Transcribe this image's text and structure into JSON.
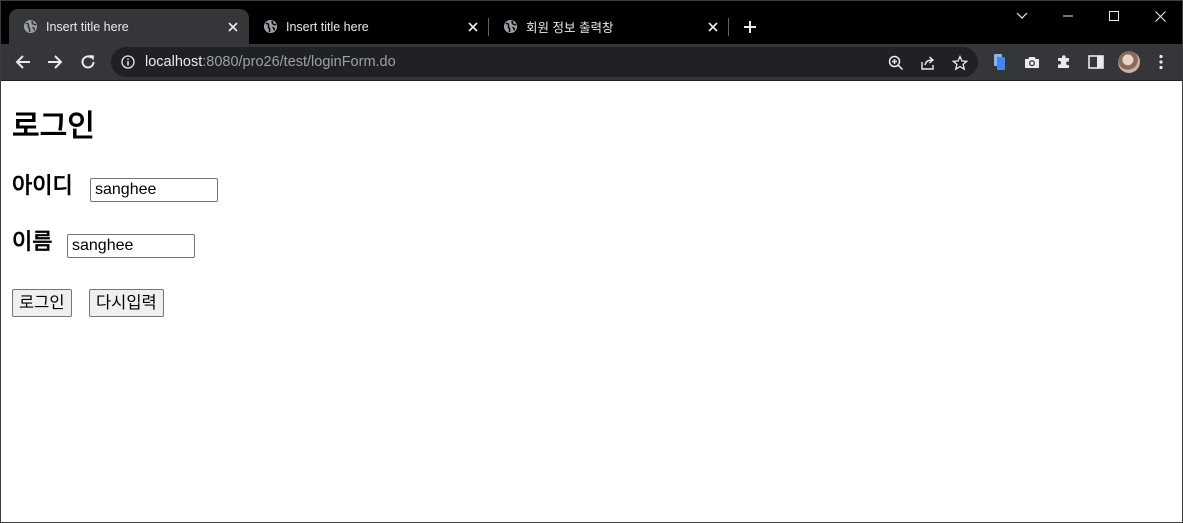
{
  "tabs": [
    {
      "title": "Insert title here",
      "active": true
    },
    {
      "title": "Insert title here",
      "active": false
    },
    {
      "title": "회원 정보 출력창",
      "active": false
    }
  ],
  "address_bar": {
    "host": "localhost",
    "path": ":8080/pro26/test/loginForm.do"
  },
  "page": {
    "heading": "로그인",
    "id_label": "아이디",
    "id_value": "sanghee",
    "name_label": "이름",
    "name_value": "sanghee",
    "login_button": "로그인",
    "reset_button": "다시입력"
  },
  "colors": {
    "tabstrip": "#000000",
    "toolbar": "#35363a",
    "omnibox": "#202124",
    "tab_text": "#e8eaed",
    "url_path": "#9aa0a6"
  },
  "icons": [
    "globe-icon",
    "close-icon",
    "plus-icon",
    "chevron-down-icon",
    "minimize-icon",
    "maximize-icon",
    "window-close-icon",
    "back-icon",
    "forward-icon",
    "reload-icon",
    "info-icon",
    "zoom-icon",
    "share-icon",
    "star-icon",
    "docs-icon",
    "camera-icon",
    "puzzle-icon",
    "sidepanel-icon",
    "kebab-menu-icon"
  ]
}
